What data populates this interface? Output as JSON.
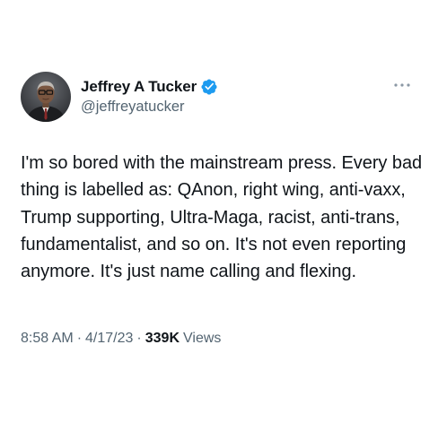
{
  "author": {
    "display_name": "Jeffrey A Tucker",
    "handle": "@jeffreyatucker",
    "verified": true,
    "verified_color": "#1d9bf0"
  },
  "tweet": {
    "text": "I'm so bored with the mainstream press. Every bad thing is labelled as: QAnon, right wing, anti-vaxx, Trump supporting, Ultra-Maga, racist, anti-trans, fundamentalist, and so on. It's not even reporting anymore. It's just name calling and flexing.",
    "time": "8:58 AM",
    "separator": "·",
    "date": "4/17/23",
    "views_count": "339K",
    "views_label": "Views"
  },
  "icons": {
    "more": "more-horizontal-icon",
    "verified": "verified-badge-icon"
  },
  "colors": {
    "text_primary": "#0f1419",
    "text_secondary": "#536471",
    "background": "#ffffff"
  }
}
